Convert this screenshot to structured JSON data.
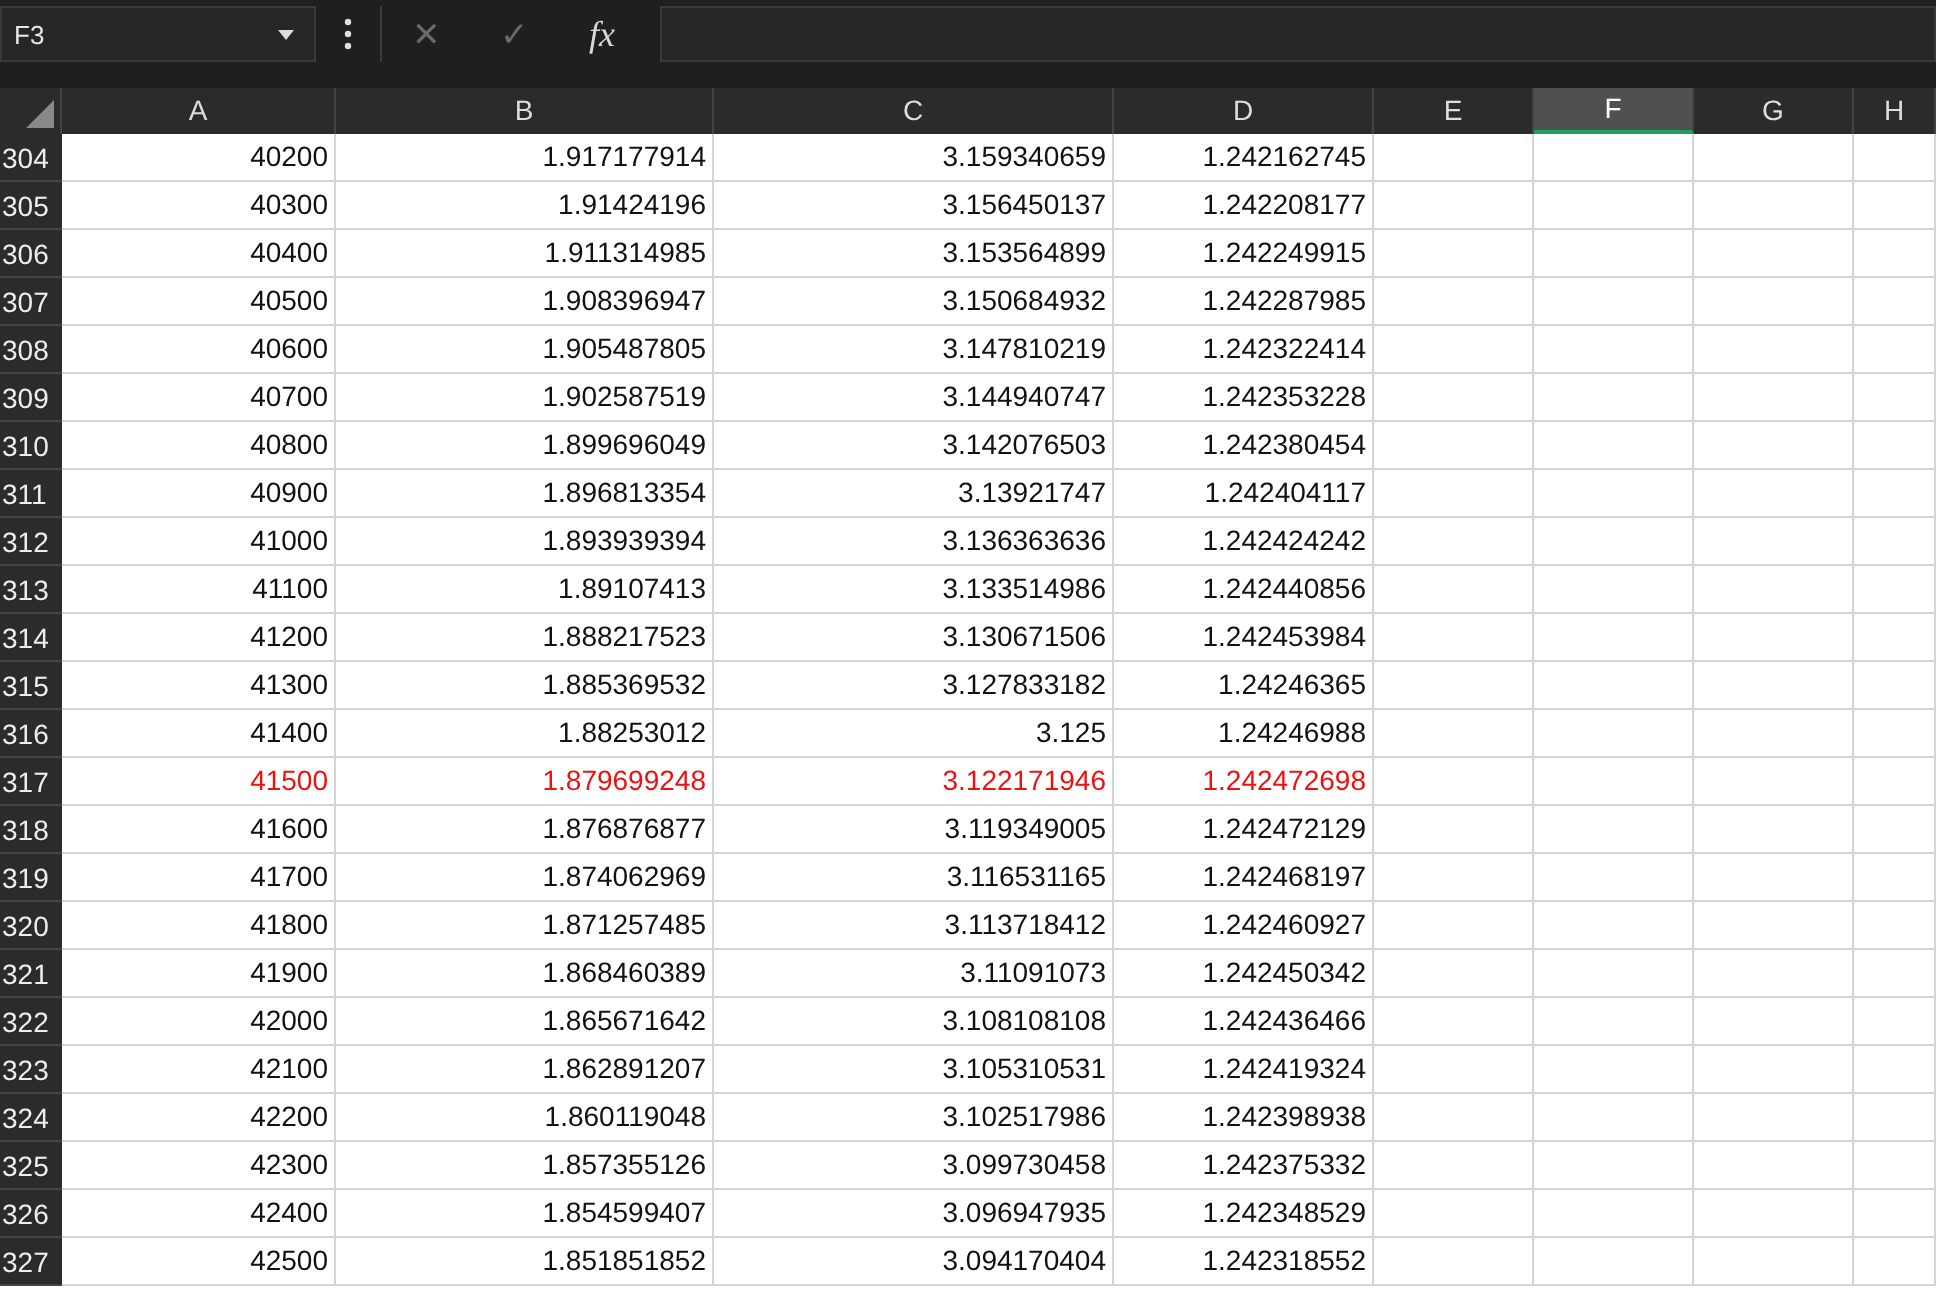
{
  "name_box": {
    "value": "F3"
  },
  "formula_bar": {
    "cancel": "✕",
    "enter": "✓",
    "function": "fx"
  },
  "columns": [
    {
      "label": "A",
      "selected": false
    },
    {
      "label": "B",
      "selected": false
    },
    {
      "label": "C",
      "selected": false
    },
    {
      "label": "D",
      "selected": false
    },
    {
      "label": "E",
      "selected": false
    },
    {
      "label": "F",
      "selected": true
    },
    {
      "label": "G",
      "selected": false
    },
    {
      "label": "H",
      "selected": false
    }
  ],
  "rows": [
    {
      "number": "304",
      "cells": [
        "40200",
        "1.917177914",
        "3.159340659",
        "1.242162745"
      ],
      "highlighted": false
    },
    {
      "number": "305",
      "cells": [
        "40300",
        "1.91424196",
        "3.156450137",
        "1.242208177"
      ],
      "highlighted": false
    },
    {
      "number": "306",
      "cells": [
        "40400",
        "1.911314985",
        "3.153564899",
        "1.242249915"
      ],
      "highlighted": false
    },
    {
      "number": "307",
      "cells": [
        "40500",
        "1.908396947",
        "3.150684932",
        "1.242287985"
      ],
      "highlighted": false
    },
    {
      "number": "308",
      "cells": [
        "40600",
        "1.905487805",
        "3.147810219",
        "1.242322414"
      ],
      "highlighted": false
    },
    {
      "number": "309",
      "cells": [
        "40700",
        "1.902587519",
        "3.144940747",
        "1.242353228"
      ],
      "highlighted": false
    },
    {
      "number": "310",
      "cells": [
        "40800",
        "1.899696049",
        "3.142076503",
        "1.242380454"
      ],
      "highlighted": false
    },
    {
      "number": "311",
      "cells": [
        "40900",
        "1.896813354",
        "3.13921747",
        "1.242404117"
      ],
      "highlighted": false
    },
    {
      "number": "312",
      "cells": [
        "41000",
        "1.893939394",
        "3.136363636",
        "1.242424242"
      ],
      "highlighted": false
    },
    {
      "number": "313",
      "cells": [
        "41100",
        "1.89107413",
        "3.133514986",
        "1.242440856"
      ],
      "highlighted": false
    },
    {
      "number": "314",
      "cells": [
        "41200",
        "1.888217523",
        "3.130671506",
        "1.242453984"
      ],
      "highlighted": false
    },
    {
      "number": "315",
      "cells": [
        "41300",
        "1.885369532",
        "3.127833182",
        "1.24246365"
      ],
      "highlighted": false
    },
    {
      "number": "316",
      "cells": [
        "41400",
        "1.88253012",
        "3.125",
        "1.24246988"
      ],
      "highlighted": false
    },
    {
      "number": "317",
      "cells": [
        "41500",
        "1.879699248",
        "3.122171946",
        "1.242472698"
      ],
      "highlighted": true
    },
    {
      "number": "318",
      "cells": [
        "41600",
        "1.876876877",
        "3.119349005",
        "1.242472129"
      ],
      "highlighted": false
    },
    {
      "number": "319",
      "cells": [
        "41700",
        "1.874062969",
        "3.116531165",
        "1.242468197"
      ],
      "highlighted": false
    },
    {
      "number": "320",
      "cells": [
        "41800",
        "1.871257485",
        "3.113718412",
        "1.242460927"
      ],
      "highlighted": false
    },
    {
      "number": "321",
      "cells": [
        "41900",
        "1.868460389",
        "3.11091073",
        "1.242450342"
      ],
      "highlighted": false
    },
    {
      "number": "322",
      "cells": [
        "42000",
        "1.865671642",
        "3.108108108",
        "1.242436466"
      ],
      "highlighted": false
    },
    {
      "number": "323",
      "cells": [
        "42100",
        "1.862891207",
        "3.105310531",
        "1.242419324"
      ],
      "highlighted": false
    },
    {
      "number": "324",
      "cells": [
        "42200",
        "1.860119048",
        "3.102517986",
        "1.242398938"
      ],
      "highlighted": false
    },
    {
      "number": "325",
      "cells": [
        "42300",
        "1.857355126",
        "3.099730458",
        "1.242375332"
      ],
      "highlighted": false
    },
    {
      "number": "326",
      "cells": [
        "42400",
        "1.854599407",
        "3.096947935",
        "1.242348529"
      ],
      "highlighted": false
    },
    {
      "number": "327",
      "cells": [
        "42500",
        "1.851851852",
        "3.094170404",
        "1.242318552"
      ],
      "highlighted": false
    }
  ]
}
